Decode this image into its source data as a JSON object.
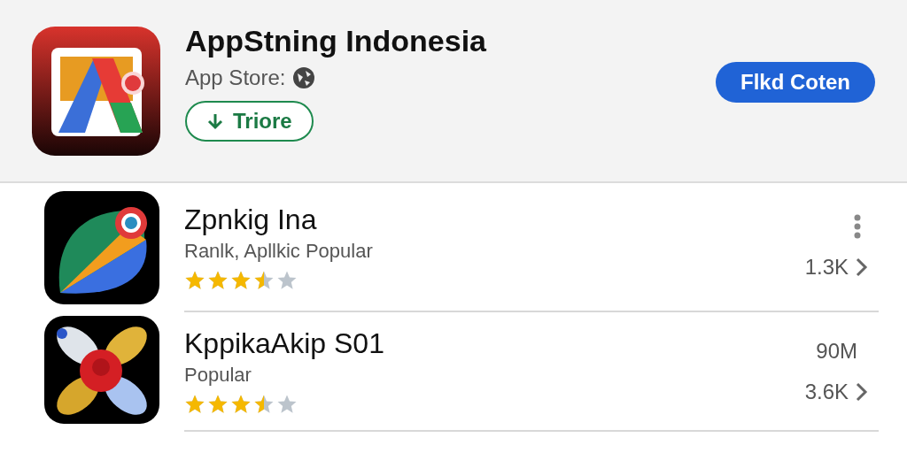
{
  "featured": {
    "title": "AppStning Indonesia",
    "subtitle": "App Store:",
    "install_button": "Triore",
    "action_button": "Flkd Coten"
  },
  "apps": [
    {
      "title": "Zpnkig Ina",
      "subtitle": "Ranlk, Apllkic Popular",
      "stars": 3.5,
      "count": "1.3K",
      "menu": true
    },
    {
      "title": "KppikaAkip S01",
      "subtitle": "Popular",
      "stars": 3.5,
      "size": "90M",
      "count": "3.6K",
      "menu": false
    }
  ]
}
